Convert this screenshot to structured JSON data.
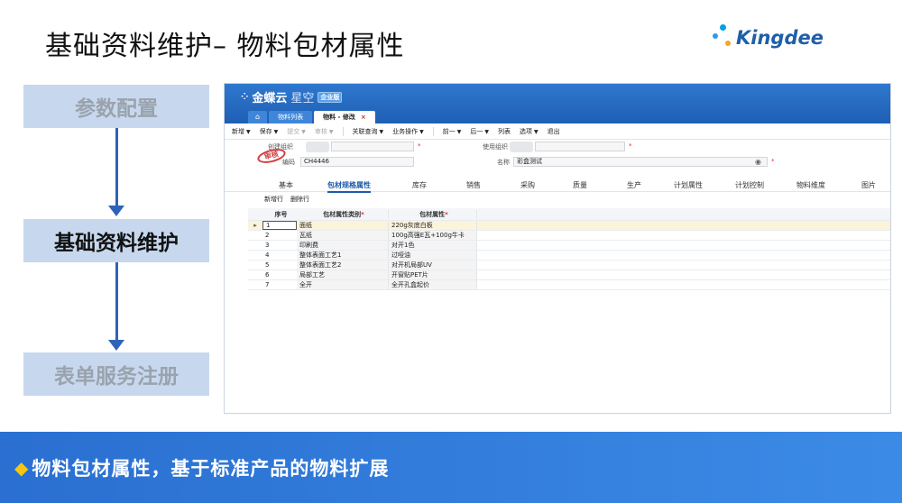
{
  "slide": {
    "title": "基础资料维护– 物料包材属性",
    "logo_text": "Kingdee"
  },
  "flow": {
    "steps": [
      "参数配置",
      "基础资料维护",
      "表单服务注册"
    ],
    "active_index": 1
  },
  "app": {
    "brand": "金蝶云",
    "brand_suffix": "星空",
    "brand_tag": "企业版",
    "tabs": [
      {
        "label": "物料列表"
      },
      {
        "label": "物料 - 修改",
        "close": "×"
      }
    ],
    "toolbar": [
      {
        "label": "新增",
        "caret": "▼",
        "enabled": true
      },
      {
        "label": "保存",
        "caret": "▼",
        "enabled": true
      },
      {
        "label": "提交",
        "caret": "▼",
        "enabled": false
      },
      {
        "label": "审核",
        "caret": "▼",
        "enabled": false
      },
      {
        "label": "关联查询",
        "caret": "▼",
        "enabled": true
      },
      {
        "label": "业务操作",
        "caret": "▼",
        "enabled": true
      },
      {
        "label": "前一",
        "caret": "▼",
        "enabled": true
      },
      {
        "label": "后一",
        "caret": "▼",
        "enabled": true
      },
      {
        "label": "列表",
        "caret": "",
        "enabled": true
      },
      {
        "label": "选项",
        "caret": "▼",
        "enabled": true
      },
      {
        "label": "退出",
        "caret": "",
        "enabled": true
      }
    ],
    "form": {
      "create_org_label": "创建组织",
      "code_label": "编码",
      "code_value": "CH4446",
      "use_org_label": "使用组织",
      "name_label": "名称",
      "name_value": "彩盒测试",
      "stamp": "审核",
      "required_mark": "*"
    },
    "sub_tabs": [
      "基本",
      "包材规格属性",
      "库存",
      "销售",
      "采购",
      "质量",
      "生产",
      "计划属性",
      "计划控制",
      "物料维度",
      "图片"
    ],
    "active_sub_tab": 1,
    "grid_toolbar": [
      "新增行",
      "删除行"
    ],
    "grid": {
      "columns": [
        "序号",
        "包材属性类别",
        "包材属性"
      ],
      "required_mark": "*",
      "row_marker": "▸",
      "rows": [
        {
          "seq": "1",
          "type": "面纸",
          "attr": "220g灰底白板"
        },
        {
          "seq": "2",
          "type": "瓦纸",
          "attr": "100g高强E瓦+100g牛卡"
        },
        {
          "seq": "3",
          "type": "印刷费",
          "attr": "对开1色"
        },
        {
          "seq": "4",
          "type": "整体表面工艺1",
          "attr": "过哑油"
        },
        {
          "seq": "5",
          "type": "整体表面工艺2",
          "attr": "对开机局部UV"
        },
        {
          "seq": "6",
          "type": "局部工艺",
          "attr": "开窗贴PET片"
        },
        {
          "seq": "7",
          "type": "全开",
          "attr": "全开孔盒起价"
        }
      ]
    }
  },
  "banner": {
    "bullet": "◆",
    "text": "物料包材属性，基于标准产品的物料扩展"
  },
  "colors": {
    "accent_blue": "#2e63b8",
    "flow_box": "#c7d8ee",
    "banner": "#2a6fd1",
    "bullet": "#f5c518"
  }
}
